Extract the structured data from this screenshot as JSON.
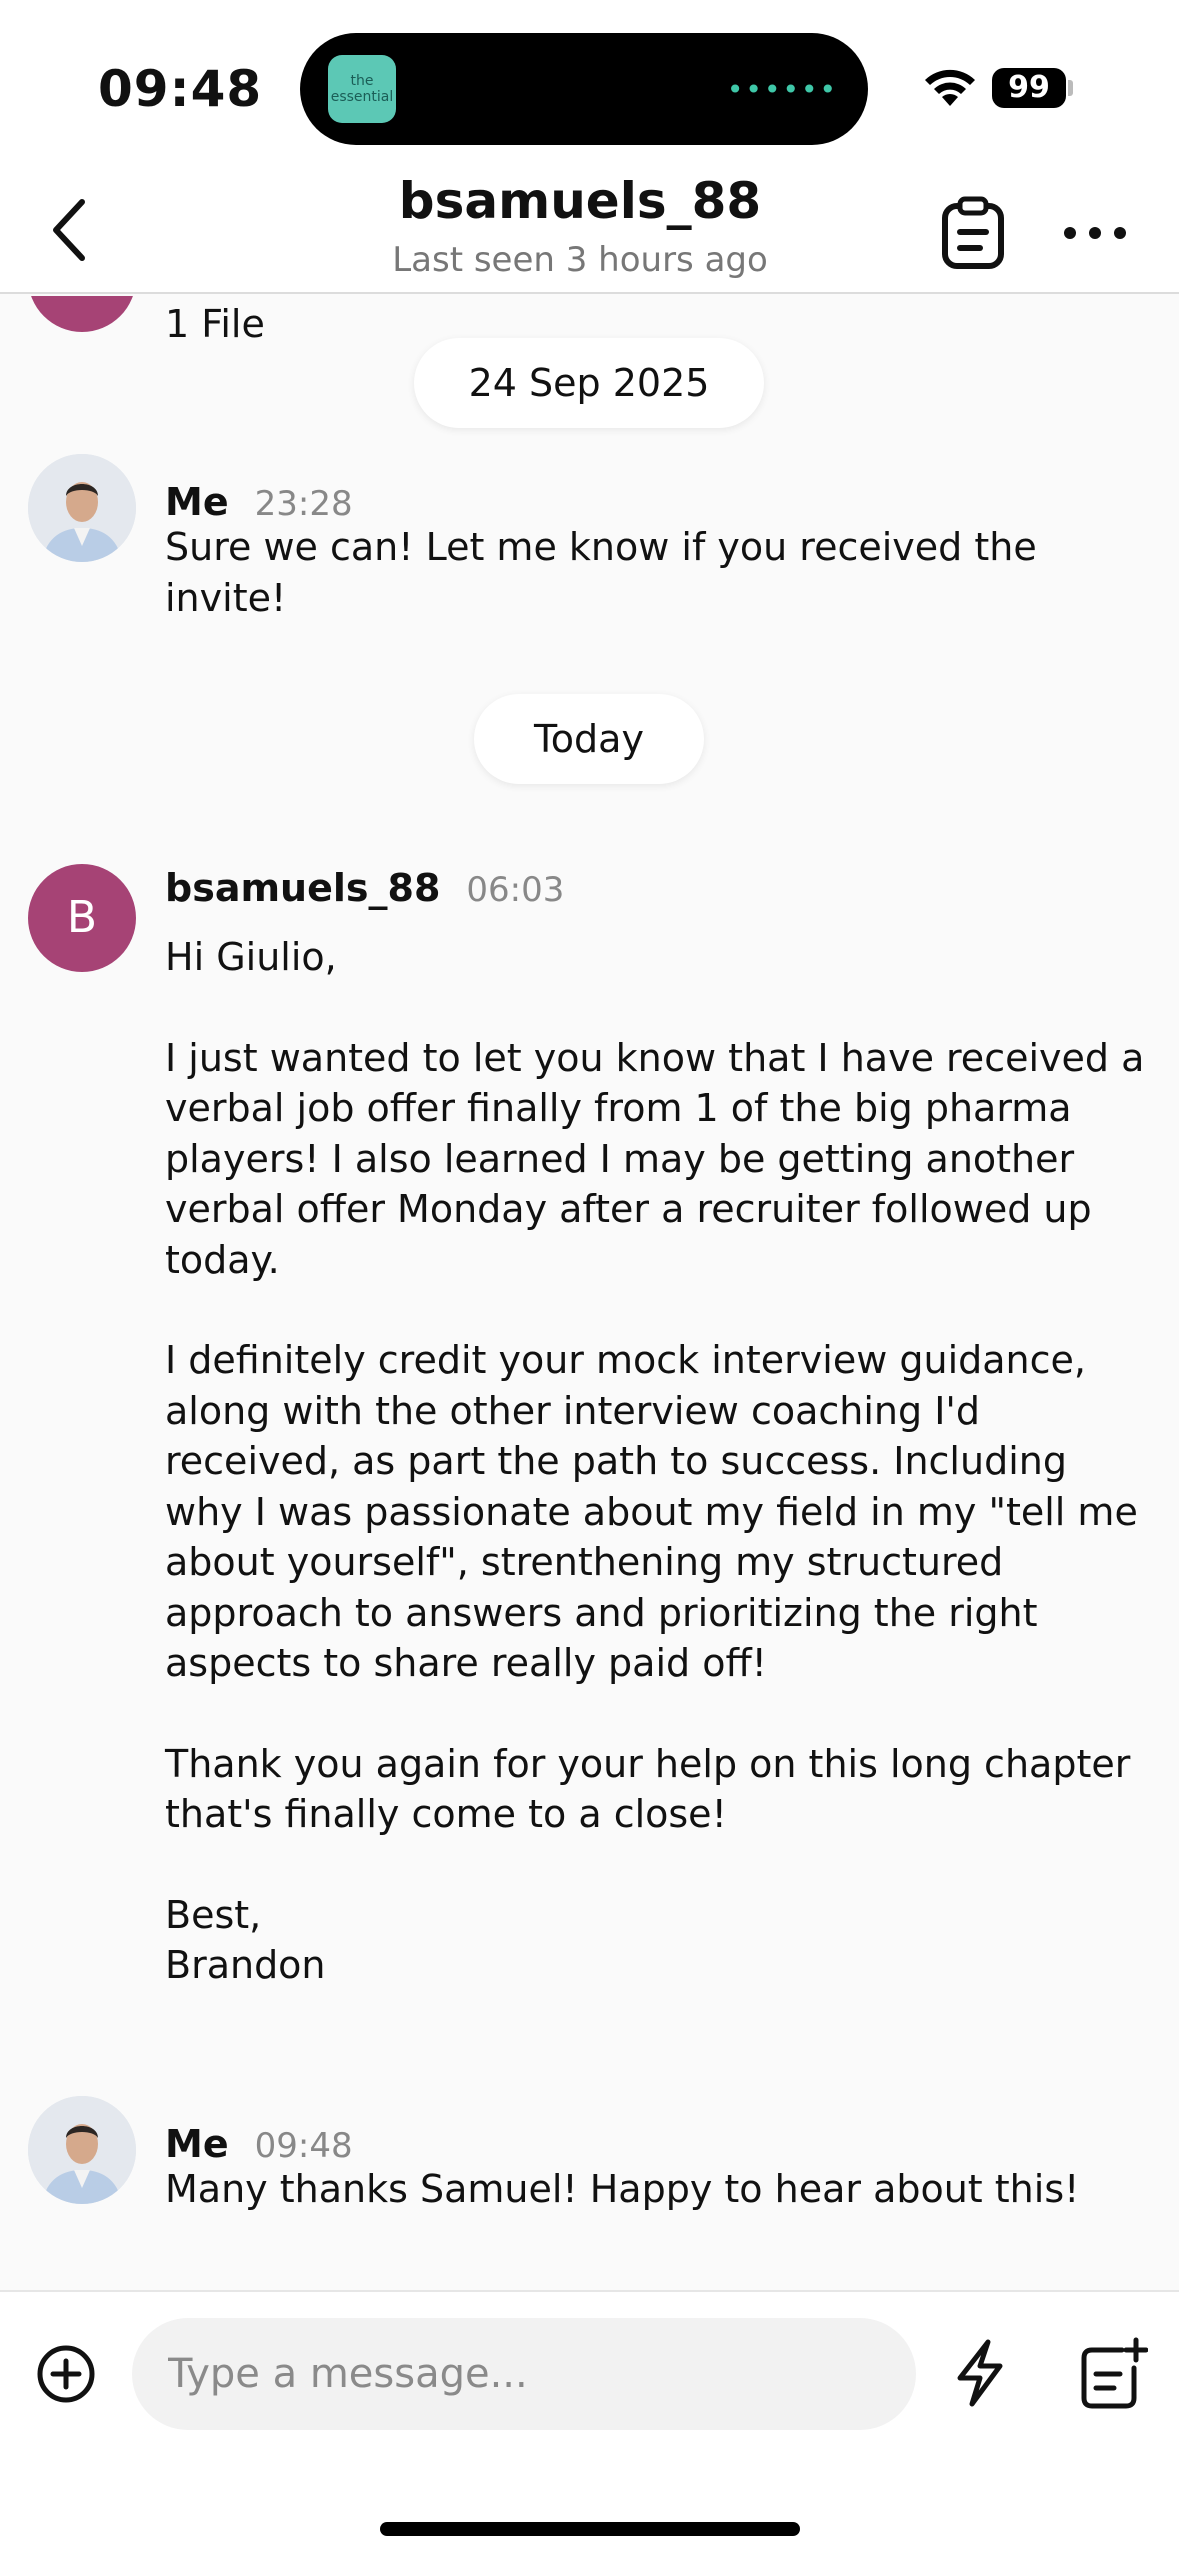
{
  "status_bar": {
    "time": "09:48",
    "battery": "99",
    "island_app_label": "the essential"
  },
  "header": {
    "title": "bsamuels_88",
    "subtitle": "Last seen 3 hours ago",
    "back_icon": "chevron-left-icon",
    "notes_icon": "clipboard-icon",
    "more_icon": "ellipsis-icon"
  },
  "partial_message": {
    "text": "1 File"
  },
  "date_separators": [
    "24 Sep 2025",
    "Today"
  ],
  "messages": [
    {
      "sender": "Me",
      "time": "23:28",
      "paragraphs": [
        "Sure we can! Let me know if you received the invite!"
      ]
    },
    {
      "sender": "bsamuels_88",
      "avatar_letter": "B",
      "time": "06:03",
      "paragraphs": [
        "Hi Giulio,",
        "I just wanted to let you know that I have received a verbal job offer finally from 1 of the big pharma players! I also learned I may be getting another verbal offer Monday after a recruiter followed up today.",
        "I definitely credit your mock interview guidance, along with the other interview coaching I'd received, as part the path to success. Including why I was passionate about my field in my \"tell me about yourself\", strenthening my structured approach to answers and prioritizing the right aspects to share really paid off!",
        "Thank you again for your help on this long chapter that's finally come to a close!",
        "Best,\nBrandon"
      ]
    },
    {
      "sender": "Me",
      "time": "09:48",
      "paragraphs": [
        "Many thanks Samuel! Happy to hear about this!"
      ]
    }
  ],
  "composer": {
    "placeholder": "Type a message...",
    "add_icon": "plus-circle-icon",
    "quick_reply_icon": "lightning-icon",
    "template_icon": "note-add-icon"
  },
  "colors": {
    "avatar_accent": "#a64375",
    "island_accent": "#3fc7a8"
  }
}
